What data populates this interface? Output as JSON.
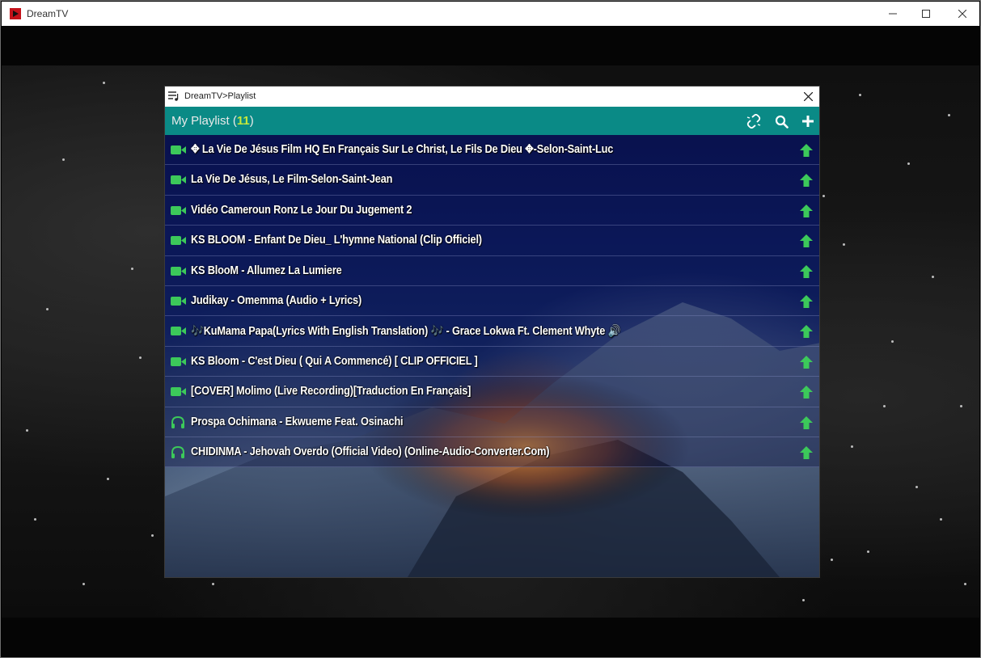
{
  "window": {
    "title": "DreamTV"
  },
  "dialog": {
    "title": "DreamTV>Playlist"
  },
  "playlist": {
    "title_prefix": "My Playlist (",
    "count": "11",
    "title_suffix": ")"
  },
  "colors": {
    "accent": "#0a8a86",
    "icon_green": "#3cc95a",
    "count_yellow": "#c8e83a"
  },
  "items": [
    {
      "type": "video",
      "icon": "video-camera-icon",
      "label": "✥ La Vie De Jésus Film HQ En Français Sur Le Christ, Le Fils De Dieu ✥-Selon-Saint-Luc"
    },
    {
      "type": "video",
      "icon": "video-camera-icon",
      "label": "La Vie De Jésus, Le Film-Selon-Saint-Jean"
    },
    {
      "type": "video",
      "icon": "video-camera-icon",
      "label": "Vidéo Cameroun Ronz Le Jour Du Jugement 2"
    },
    {
      "type": "video",
      "icon": "video-camera-icon",
      "label": "KS BLOOM - Enfant De Dieu_ L'hymne National (Clip Officiel)"
    },
    {
      "type": "video",
      "icon": "video-camera-icon",
      "label": "KS BlooM - Allumez La Lumiere"
    },
    {
      "type": "video",
      "icon": "video-camera-icon",
      "label": "Judikay - Omemma (Audio + Lyrics)"
    },
    {
      "type": "video",
      "icon": "video-camera-icon",
      "label": " 🎶KuMama Papa(Lyrics With English Translation) 🎶 - Grace Lokwa Ft. Clement Whyte 🔊"
    },
    {
      "type": "video",
      "icon": "video-camera-icon",
      "label": "KS Bloom - C'est Dieu ( Qui A Commencé) [ CLIP OFFICIEL ]"
    },
    {
      "type": "video",
      "icon": "video-camera-icon",
      "label": "[COVER] Molimo (Live Recording)[Traduction En Français]"
    },
    {
      "type": "audio",
      "icon": "headphones-icon",
      "label": "Prospa Ochimana - Ekwueme Feat. Osinachi"
    },
    {
      "type": "audio",
      "icon": "headphones-icon",
      "label": "CHIDINMA - Jehovah Overdo (Official Video) (Online-Audio-Converter.Com)"
    }
  ]
}
